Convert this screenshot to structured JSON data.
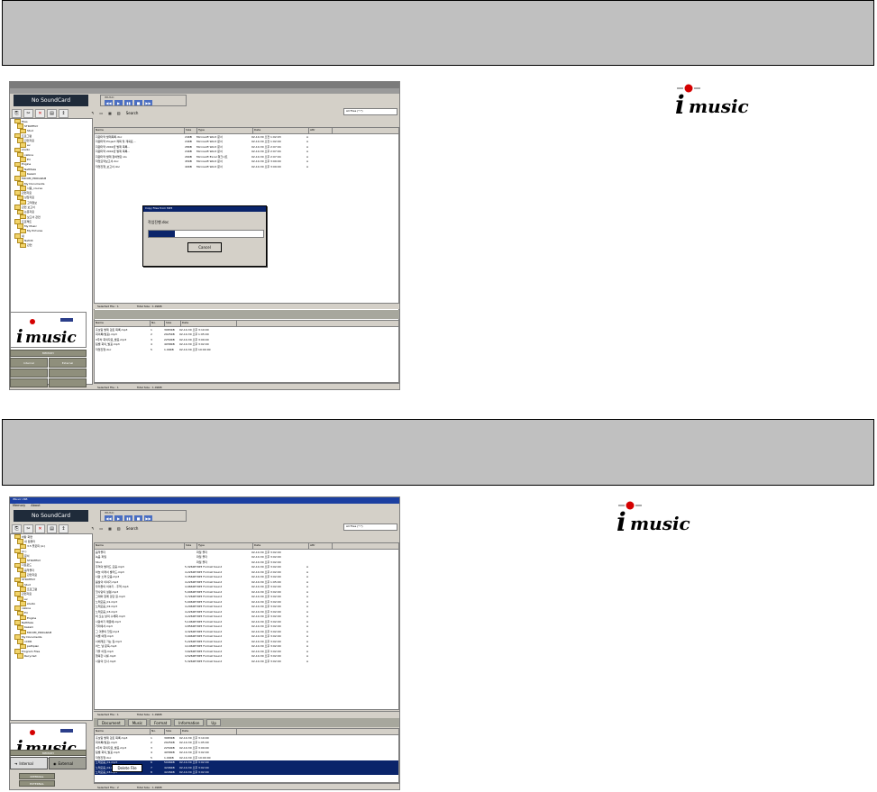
{
  "shot1": {
    "soundcard": "No SoundCard",
    "player_info": "IMUSIC",
    "combo": "All Files (*.*)",
    "toolbar_search": "Search",
    "file_headers": [
      "Name",
      "Size",
      "Type",
      "Date",
      "Attr"
    ],
    "files": [
      {
        "name": "지원마약 발제목록.doc",
        "size": "24KB",
        "type": "Microsoft Word 문서",
        "date": "02-10-30 오전 1:02:03",
        "attr": "A"
      },
      {
        "name": "지원마약 Project 제목 및 계획표...",
        "size": "24KB",
        "type": "Microsoft Word 문서",
        "date": "02-10-30 오전 1:02:00",
        "attr": "A"
      },
      {
        "name": "지원마약 2002년 발제 목록...",
        "size": "28KB",
        "type": "Microsoft Word 문서",
        "date": "02-10-30 오후 2:07:04",
        "attr": "A"
      },
      {
        "name": "지원마약 2002년 발제 목록...",
        "size": "24KB",
        "type": "Microsoft Word 문서",
        "date": "02-10-30 오후 2:07:04",
        "attr": "A"
      },
      {
        "name": "지원마약 발제 참여명단.xls",
        "size": "26KB",
        "type": "Microsoft Excel 워크시트",
        "date": "02-10-30 오후 2:07:04",
        "attr": "A"
      },
      {
        "name": "작업요약보고서.doc",
        "size": "45KB",
        "type": "Microsoft Word 문서",
        "date": "02-10-30 오후 3:09:00",
        "attr": "A"
      },
      {
        "name": "작업진행_보고서.doc",
        "size": "40KB",
        "type": "Microsoft Word 문서",
        "date": "02-10-30 오후 3:09:00",
        "attr": "A"
      }
    ],
    "tree": [
      "Files",
      "STRATEGY",
      "Stud",
      "프로그램",
      "관련자료",
      "ev",
      "studio",
      "cabina",
      "Eri",
      "Engine",
      "NetMaze",
      "Kazam",
      "MICOM_PROGRAM",
      "My Documents",
      "사용_course",
      "관련자료",
      "상담자료",
      "고객정보",
      "관련 보고서",
      "논문자료",
      "보고서 관련",
      "프로젝트",
      "My Music",
      "My Pictures",
      "새",
      "NetOK",
      "관련"
    ],
    "dialog_title": "Copy Files from MP3",
    "dialog_file": "작업진행.doc",
    "dialog_progress": 0.23,
    "dialog_cancel": "Cancel",
    "status_top": "Selected File : 1",
    "status_top_total": "Total Size : 1.09KB",
    "logo_text": "music",
    "logo_label": "MEMORY",
    "left_buttons": [
      "Internal",
      "External"
    ],
    "mp3_headers": [
      "Name",
      "No.",
      "Size",
      "Date"
    ],
    "mp3_files": [
      {
        "name": "홍보팀 발제 검토 목록.mp3",
        "no": "1",
        "size": "3983KB",
        "date": "02-10-30 오후 3:10:00"
      },
      {
        "name": "회의록(발표).mp3",
        "no": "2",
        "size": "2925KB",
        "date": "02-10-30 오후 1:05:00"
      },
      {
        "name": "3주차 회의자료_발표.mp3",
        "no": "3",
        "size": "2250KB",
        "date": "02-10-30 오후 3:09:00"
      },
      {
        "name": "팀별 회의_발표.mp3",
        "no": "4",
        "size": "4058KB",
        "date": "02-10-30 오후 3:02:00"
      },
      {
        "name": "작업진행.doc",
        "no": "5",
        "size": "1.09KB",
        "date": "02-10-30 오후 10:00:00"
      }
    ],
    "status_bottom": "Selected File : 1",
    "status_bottom_total": "Total Size : 1.09KB"
  },
  "shot2": {
    "title": "iMusic USB",
    "menu": [
      "Memory",
      "About"
    ],
    "soundcard": "No SoundCard",
    "player_info": "IMUSIC",
    "combo": "All Files (*.*)",
    "toolbar_search": "Search",
    "file_headers": [
      "Name",
      "Size",
      "Type",
      "Date",
      "Attr"
    ],
    "files": [
      {
        "name": "음악폴더",
        "size": "",
        "type": "파일 폴더",
        "date": "02-10-30 오후 3:02:00",
        "attr": ""
      },
      {
        "name": "녹음 파일",
        "size": "",
        "type": "파일 폴더",
        "date": "02-10-30 오후 3:02:00",
        "attr": ""
      },
      {
        "name": "Stud",
        "size": "",
        "type": "파일 폴더",
        "date": "02-10-30 오후 3:02:00",
        "attr": ""
      },
      {
        "name": "추억의 발라드 모음.mp3",
        "size": "5,326KB",
        "type": "MP3 Format Sound",
        "date": "02-10-30 오후 3:02:00",
        "attr": "A"
      },
      {
        "name": "하늘 아래서 발라드.mp3",
        "size": "4,226KB",
        "type": "MP3 Format Sound",
        "date": "02-10-30 오후 2:02:00",
        "attr": "A"
      },
      {
        "name": "사랑 노래 모음.mp3",
        "size": "3,356KB",
        "type": "MP3 Format Sound",
        "date": "02-10-30 오후 3:02:00",
        "attr": "A"
      },
      {
        "name": "봄날의 이야기.mp3",
        "size": "4,226KB",
        "type": "MP3 Format Sound",
        "date": "02-10-30 오후 1:05:00",
        "attr": "A"
      },
      {
        "name": "우리들의 이야기 - 추억.mp3",
        "size": "4,966KB",
        "type": "MP3 Format Sound",
        "date": "02-10-30 오후 3:02:00",
        "attr": "A"
      },
      {
        "name": "첫사랑의 설렘.mp3",
        "size": "5,006KB",
        "type": "MP3 Format Sound",
        "date": "02-10-30 오후 3:02:00",
        "attr": "A"
      },
      {
        "name": "그대와 함께 걷던 길.mp3",
        "size": "3,726KB",
        "type": "MP3 Format Sound",
        "date": "02-10-30 오후 3:02:00",
        "attr": "A"
      },
      {
        "name": "노래모음_01.mp3",
        "size": "5,006KB",
        "type": "MP3 Format Sound",
        "date": "02-10-30 오후 3:02:00",
        "attr": "A"
      },
      {
        "name": "노래모음_02.mp3",
        "size": "4,206KB",
        "type": "MP3 Format Sound",
        "date": "02-10-30 오후 3:02:00",
        "attr": "A"
      },
      {
        "name": "노래모음_03.mp3",
        "size": "4,226KB",
        "type": "MP3 Format Sound",
        "date": "02-10-30 오후 3:02:00",
        "attr": "A"
      },
      {
        "name": "비 오는 날의 수채화.mp3",
        "size": "4,226KB",
        "type": "MP3 Format Sound",
        "date": "02-10-30 오후 3:02:00",
        "attr": "A"
      },
      {
        "name": "사랑하기 때문에.mp3",
        "size": "5,106KB",
        "type": "MP3 Format Sound",
        "date": "02-10-30 오후 3:02:00",
        "attr": "A"
      },
      {
        "name": "거리에서.mp3",
        "size": "4,856KB",
        "type": "MP3 Format Sound",
        "date": "02-10-30 오후 3:02:00",
        "attr": "A"
      },
      {
        "name": "그 겨울의 찻집.mp3",
        "size": "4,326KB",
        "type": "MP3 Format Sound",
        "date": "02-10-30 오후 3:02:00",
        "attr": "A"
      },
      {
        "name": "이별 여행.mp3",
        "size": "3,906KB",
        "type": "MP3 Format Sound",
        "date": "02-10-30 오후 3:02:00",
        "attr": "A"
      },
      {
        "name": "너에게로 가는 길.mp3",
        "size": "5,226KB",
        "type": "MP3 Format Sound",
        "date": "02-10-30 오후 3:02:00",
        "attr": "A"
      },
      {
        "name": "어느 날 문득.mp3",
        "size": "4,106KB",
        "type": "MP3 Format Sound",
        "date": "02-10-30 오후 3:02:00",
        "attr": "A"
      },
      {
        "name": "가을 아침.mp3",
        "size": "3,626KB",
        "type": "MP3 Format Sound",
        "date": "02-10-30 오후 3:02:00",
        "attr": "A"
      },
      {
        "name": "행복한 나를.mp3",
        "size": "4,526KB",
        "type": "MP3 Format Sound",
        "date": "02-10-30 오후 3:02:00",
        "attr": "A"
      },
      {
        "name": "사랑의 인사.mp3",
        "size": "5,326KB",
        "type": "MP3 Format Sound",
        "date": "02-10-30 오후 3:02:00",
        "attr": "A"
      }
    ],
    "tree": [
      "바탕 화면",
      "내 컴퓨터",
      "3.5 플로피 (A:)",
      "(C:)",
      "문서",
      "STRATEGY",
      "다운로드",
      "음악폴더",
      "관련자료",
      "STRATEGY",
      "Stud",
      "프로그램",
      "관련자료",
      "ev",
      "studio",
      "cabina",
      "Eri",
      "Engine",
      "NetMaze",
      "Kazam",
      "MICOM_PROGRAM",
      "My Documents",
      "nCDR",
      "pathpian",
      "Program Files",
      "Recycled"
    ],
    "status_top": "Selected File : 1",
    "status_top_total": "Total Size : 1.09KB",
    "tabs": [
      "Document",
      "Music",
      "Format",
      "Information",
      "Up"
    ],
    "logo_text": "music",
    "logo_label": "MEMORY",
    "left_buttons": [
      "Internal",
      "External"
    ],
    "left_small": [
      "INTERNAL",
      "EXTERNAL"
    ],
    "mp3_headers": [
      "Name",
      "No.",
      "Size",
      "Date"
    ],
    "mp3_files": [
      {
        "name": "홍보팀 발제 검토 목록.mp3",
        "no": "1",
        "size": "3983KB",
        "date": "02-10-30 오후 3:10:00"
      },
      {
        "name": "회의록(발표).mp3",
        "no": "2",
        "size": "2925KB",
        "date": "02-10-30 오후 1:05:00"
      },
      {
        "name": "3주차 회의자료_발표.mp3",
        "no": "3",
        "size": "2250KB",
        "date": "02-10-30 오후 3:09:00"
      },
      {
        "name": "팀별 회의_발표.mp3",
        "no": "4",
        "size": "4058KB",
        "date": "02-10-30 오후 3:02:00"
      },
      {
        "name": "작업진행.doc",
        "no": "5",
        "size": "1.09KB",
        "date": "02-10-30 오후 10:00:00"
      },
      {
        "name": "노래모음_01.mp3",
        "no": "6",
        "size": "5006KB",
        "date": "02-10-30 오후 3:02:00"
      },
      {
        "name": "노래모음_02.mp3",
        "no": "7",
        "size": "4206KB",
        "date": "02-10-30 오후 3:02:00"
      },
      {
        "name": "노래모음_03.mp3",
        "no": "8",
        "size": "4226KB",
        "date": "02-10-30 오후 3:02:00"
      }
    ],
    "context_menu": "Delete File",
    "status_bottom": "Selected File : 2",
    "status_bottom_total": "Total Size : 1.09KB"
  },
  "logo1_text": "music",
  "logo2_text": "music",
  "colors": {
    "band": "#c0c0c0",
    "window": "#d4d0c8",
    "selection": "#0a246a",
    "logo_red": "#d40000"
  }
}
